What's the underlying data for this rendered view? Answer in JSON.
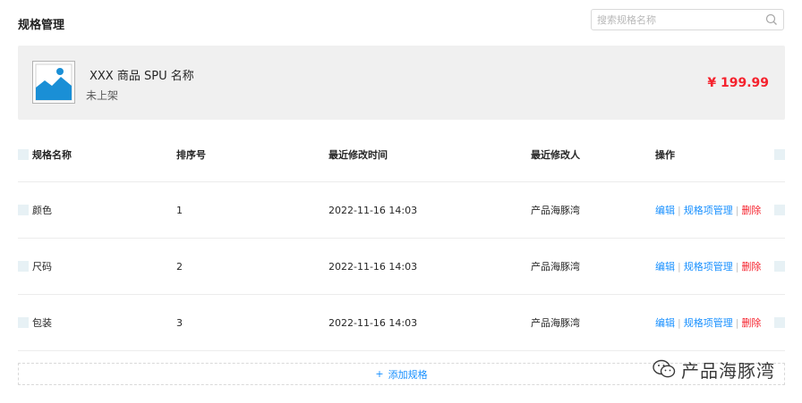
{
  "page": {
    "title": "规格管理"
  },
  "search": {
    "placeholder": "搜索规格名称",
    "icon": "search-icon"
  },
  "product": {
    "name": "XXX 商品 SPU 名称",
    "status": "未上架",
    "price": "¥ 199.99",
    "image_icon": "image-placeholder-icon"
  },
  "table": {
    "headers": [
      "规格名称",
      "排序号",
      "最近修改时间",
      "最近修改人",
      "操作"
    ],
    "rows": [
      {
        "name": "颜色",
        "order": "1",
        "time": "2022-11-16  14:03",
        "user": "产品海豚湾"
      },
      {
        "name": "尺码",
        "order": "2",
        "time": "2022-11-16  14:03",
        "user": "产品海豚湾"
      },
      {
        "name": "包装",
        "order": "3",
        "time": "2022-11-16  14:03",
        "user": "产品海豚湾"
      }
    ],
    "actions": {
      "edit": "编辑",
      "manage": "规格项管理",
      "delete": "删除",
      "separator": "|"
    }
  },
  "add_button": {
    "plus": "+",
    "label": "添加规格"
  },
  "watermark": {
    "text": "产品海豚湾",
    "icon": "wechat-icon"
  },
  "colors": {
    "primary": "#1890ff",
    "danger": "#f5222d",
    "card_bg": "#f0f0f0",
    "checkbox": "#e7f1f5"
  }
}
